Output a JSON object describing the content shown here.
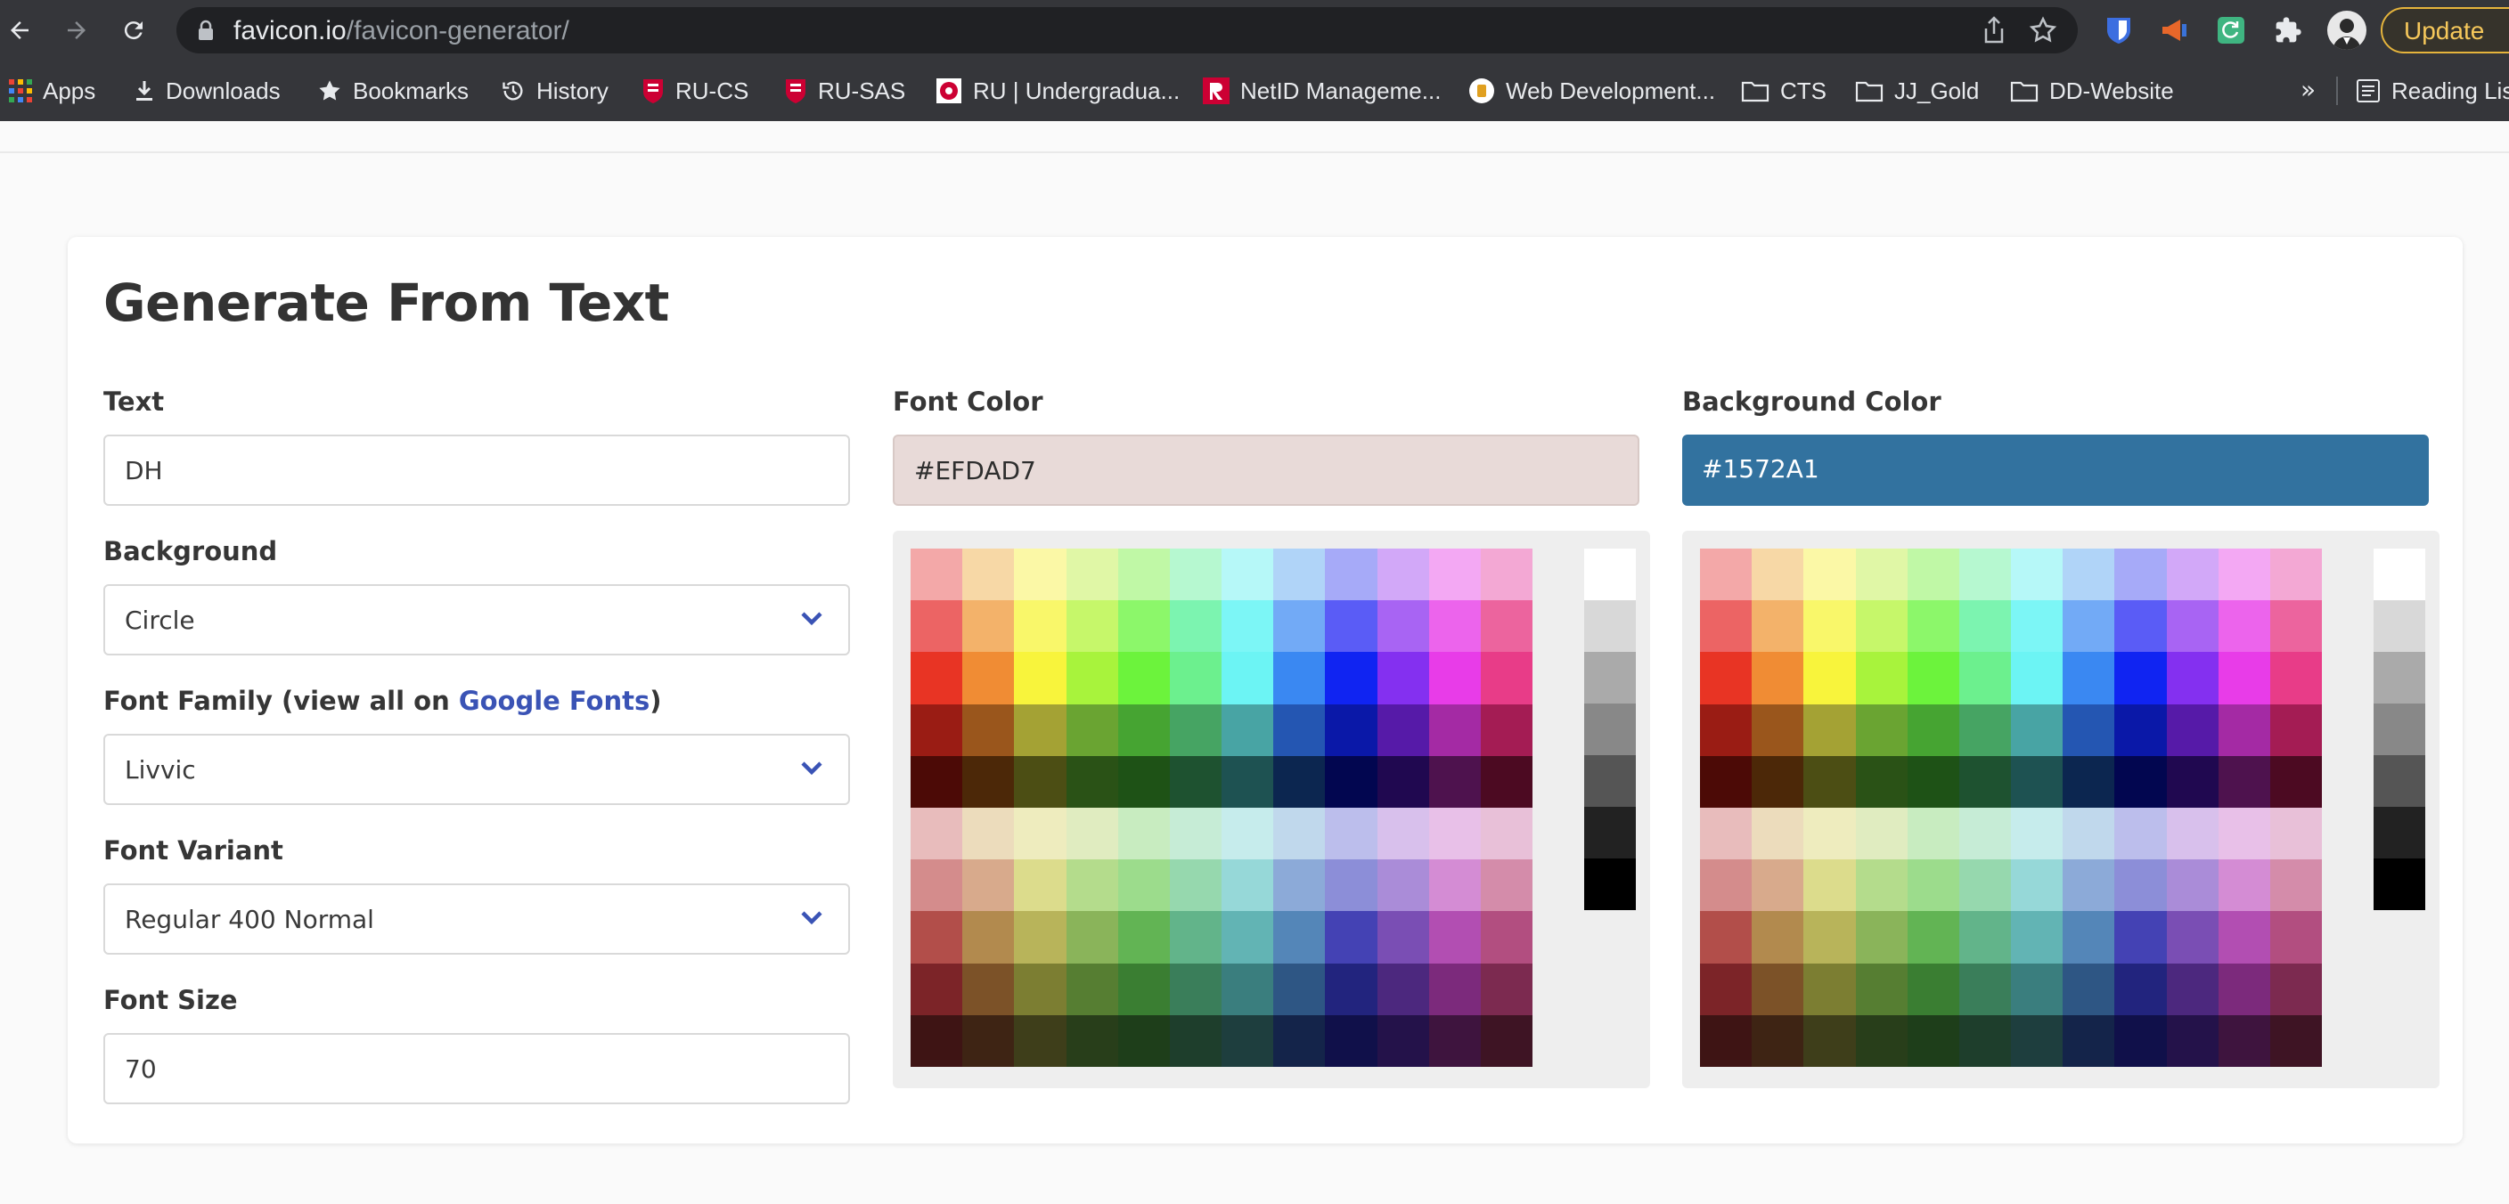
{
  "browser": {
    "url_host": "favicon.io",
    "url_path": "/favicon-generator/",
    "update_label": "Update",
    "bookmarks": {
      "apps": "Apps",
      "downloads": "Downloads",
      "bookmarks": "Bookmarks",
      "history": "History",
      "ru_cs": "RU-CS",
      "ru_sas": "RU-SAS",
      "ru_undergrad": "RU | Undergradua...",
      "netid": "NetID Manageme...",
      "webdev": "Web Development...",
      "cts": "CTS",
      "jj_gold": "JJ_Gold",
      "dd_website": "DD-Website",
      "more": "»",
      "reading_list": "Reading List"
    }
  },
  "form": {
    "title": "Generate From Text",
    "text_label": "Text",
    "text_value": "DH",
    "background_label": "Background",
    "background_value": "Circle",
    "font_family_label": "Font Family (view all on ",
    "font_family_link": "Google Fonts",
    "font_family_label_end": ")",
    "font_family_value": "Livvic",
    "font_variant_label": "Font Variant",
    "font_variant_value": "Regular 400 Normal",
    "font_size_label": "Font Size",
    "font_size_value": "70",
    "font_color_label": "Font Color",
    "font_color_value": "#EFDAD7",
    "bg_color_label": "Background Color",
    "bg_color_value": "#1572A1"
  },
  "palette": {
    "grid": [
      [
        "#f3a8a8",
        "#f7d8a6",
        "#fbf8a6",
        "#e0f7a6",
        "#c0f8a6",
        "#b6f8d0",
        "#b6f8f8",
        "#b0d4f8",
        "#a6aaf8",
        "#d2a8f8",
        "#f3a8f3",
        "#f3a8d4"
      ],
      [
        "#ec6464",
        "#f3b26a",
        "#f9f76a",
        "#c6f76a",
        "#8cf76a",
        "#7cf4b0",
        "#7cf6f6",
        "#72aaf6",
        "#5a5cf6",
        "#a864f3",
        "#ec64ec",
        "#ec649e"
      ],
      [
        "#e83424",
        "#f08c34",
        "#f8f43c",
        "#a8f33c",
        "#6cf33c",
        "#6cf08e",
        "#6cf4f4",
        "#3a88f2",
        "#1024f2",
        "#8430f0",
        "#e83ce8",
        "#e83c88"
      ],
      [
        "#9a1c14",
        "#9a561c",
        "#a4a234",
        "#6aa432",
        "#46a432",
        "#46a463",
        "#48a4a4",
        "#2456b2",
        "#0a18a8",
        "#561aa8",
        "#a42aa4",
        "#a41c54"
      ],
      [
        "#4c0a06",
        "#4c2808",
        "#4c4e14",
        "#2a5216",
        "#1e5216",
        "#1e5230",
        "#1e5252",
        "#0c2650",
        "#020650",
        "#200850",
        "#4e124e",
        "#4c0a22"
      ],
      [
        "#e8bcbc",
        "#ecdcbc",
        "#eeecbe",
        "#e0ecc0",
        "#c8ecc0",
        "#c6ecd6",
        "#c6ecec",
        "#c0d8ec",
        "#bcbeec",
        "#d8c0ec",
        "#e8c0e8",
        "#e8c0d8"
      ],
      [
        "#d48c8c",
        "#d8aa8c",
        "#dcdc8c",
        "#b4dc8c",
        "#9cdc8c",
        "#96d8ae",
        "#96d8d8",
        "#8caad8",
        "#8c8ed8",
        "#aa8cd8",
        "#d48cd4",
        "#d48caa"
      ],
      [
        "#b24e4a",
        "#b28a4e",
        "#b8b45a",
        "#8ab45a",
        "#62b454",
        "#62b48a",
        "#62b4b4",
        "#5486b8",
        "#4442b4",
        "#7a4eb4",
        "#b24eb2",
        "#b24e80"
      ],
      [
        "#7c2428",
        "#7c5228",
        "#7c7e32",
        "#567e32",
        "#3a7e32",
        "#3a7e5a",
        "#3a7e7e",
        "#2e5684",
        "#22247e",
        "#4c287e",
        "#7c2a7c",
        "#7c2a50"
      ],
      [
        "#3e1414",
        "#3e2414",
        "#3e3e1a",
        "#283e1a",
        "#1e3e1a",
        "#1e3e2c",
        "#1e3e3e",
        "#14244a",
        "#10104a",
        "#24124a",
        "#3e143e",
        "#3e1424"
      ]
    ],
    "grays": [
      "#ffffff",
      "#d8d8d8",
      "#aaaaaa",
      "#888888",
      "#555555",
      "#222222",
      "#000000"
    ]
  }
}
